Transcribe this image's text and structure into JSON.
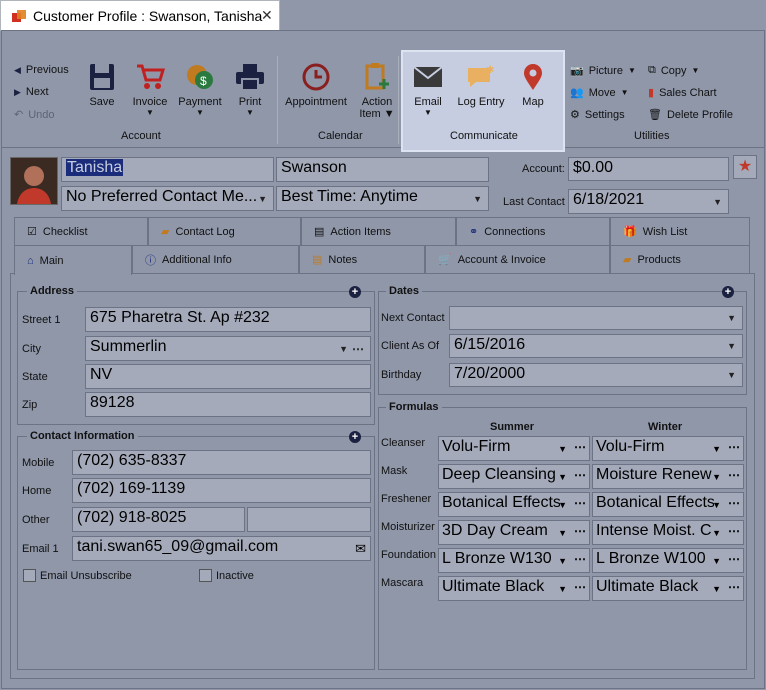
{
  "window": {
    "title": "Customer Profile : Swanson, Tanisha",
    "close": "✕"
  },
  "ribbon": {
    "nav": {
      "previous": "Previous",
      "next": "Next",
      "undo": "Undo"
    },
    "account": {
      "save": "Save",
      "invoice": "Invoice",
      "payment": "Payment",
      "print": "Print",
      "group": "Account"
    },
    "calendar": {
      "appointment": "Appointment",
      "action_item_1": "Action",
      "action_item_2": "Item",
      "group": "Calendar"
    },
    "communicate": {
      "email": "Email",
      "log_entry": "Log Entry",
      "map": "Map",
      "group": "Communicate"
    },
    "utilities": {
      "picture": "Picture",
      "move": "Move",
      "settings": "Settings",
      "copy": "Copy",
      "sales_chart": "Sales Chart",
      "delete_profile": "Delete Profile",
      "group": "Utilities"
    }
  },
  "profile": {
    "first_name": "Tanisha",
    "last_name": "Swanson",
    "contact_method": "No Preferred Contact Me...",
    "best_time": "Best Time: Anytime",
    "account_label": "Account:",
    "account_value": "$0.00",
    "last_contact_label": "Last Contact",
    "last_contact": "6/18/2021"
  },
  "tabs_row1": [
    "Checklist",
    "Contact Log",
    "Action Items",
    "Connections",
    "Wish List"
  ],
  "tabs_row2": [
    "Main",
    "Additional Info",
    "Notes",
    "Account & Invoice",
    "Products"
  ],
  "address": {
    "title": "Address",
    "street_label": "Street 1",
    "street": "675 Pharetra St. Ap #232",
    "city_label": "City",
    "city": "Summerlin",
    "state_label": "State",
    "state": "NV",
    "zip_label": "Zip",
    "zip": "89128"
  },
  "contact": {
    "title": "Contact Information",
    "mobile_label": "Mobile",
    "mobile": "(702) 635-8337",
    "home_label": "Home",
    "home": "(702) 169-1139",
    "other_label": "Other",
    "other": "(702) 918-8025",
    "email_label": "Email 1",
    "email": "tani.swan65_09@gmail.com",
    "email_unsubscribe": "Email Unsubscribe",
    "inactive": "Inactive"
  },
  "dates": {
    "title": "Dates",
    "next_contact_label": "Next Contact",
    "next_contact": "",
    "client_as_of_label": "Client As Of",
    "client_as_of": "6/15/2016",
    "birthday_label": "Birthday",
    "birthday": "7/20/2000"
  },
  "formulas": {
    "title": "Formulas",
    "summer": "Summer",
    "winter": "Winter",
    "rows": [
      {
        "label": "Cleanser",
        "summer": "Volu-Firm",
        "winter": "Volu-Firm"
      },
      {
        "label": "Mask",
        "summer": "Deep Cleansing",
        "winter": "Moisture Renew"
      },
      {
        "label": "Freshener",
        "summer": "Botanical Effects",
        "winter": "Botanical Effects"
      },
      {
        "label": "Moisturizer",
        "summer": "3D Day Cream",
        "winter": "Intense Moist. C"
      },
      {
        "label": "Foundation",
        "summer": "L Bronze W130",
        "winter": "L Bronze W100"
      },
      {
        "label": "Mascara",
        "summer": "Ultimate Black",
        "winter": "Ultimate Black"
      }
    ]
  },
  "colors": {
    "background": "#8f97a9",
    "highlight": "#c6cde0",
    "star": "#c0392b",
    "map_pin": "#c0392b"
  }
}
